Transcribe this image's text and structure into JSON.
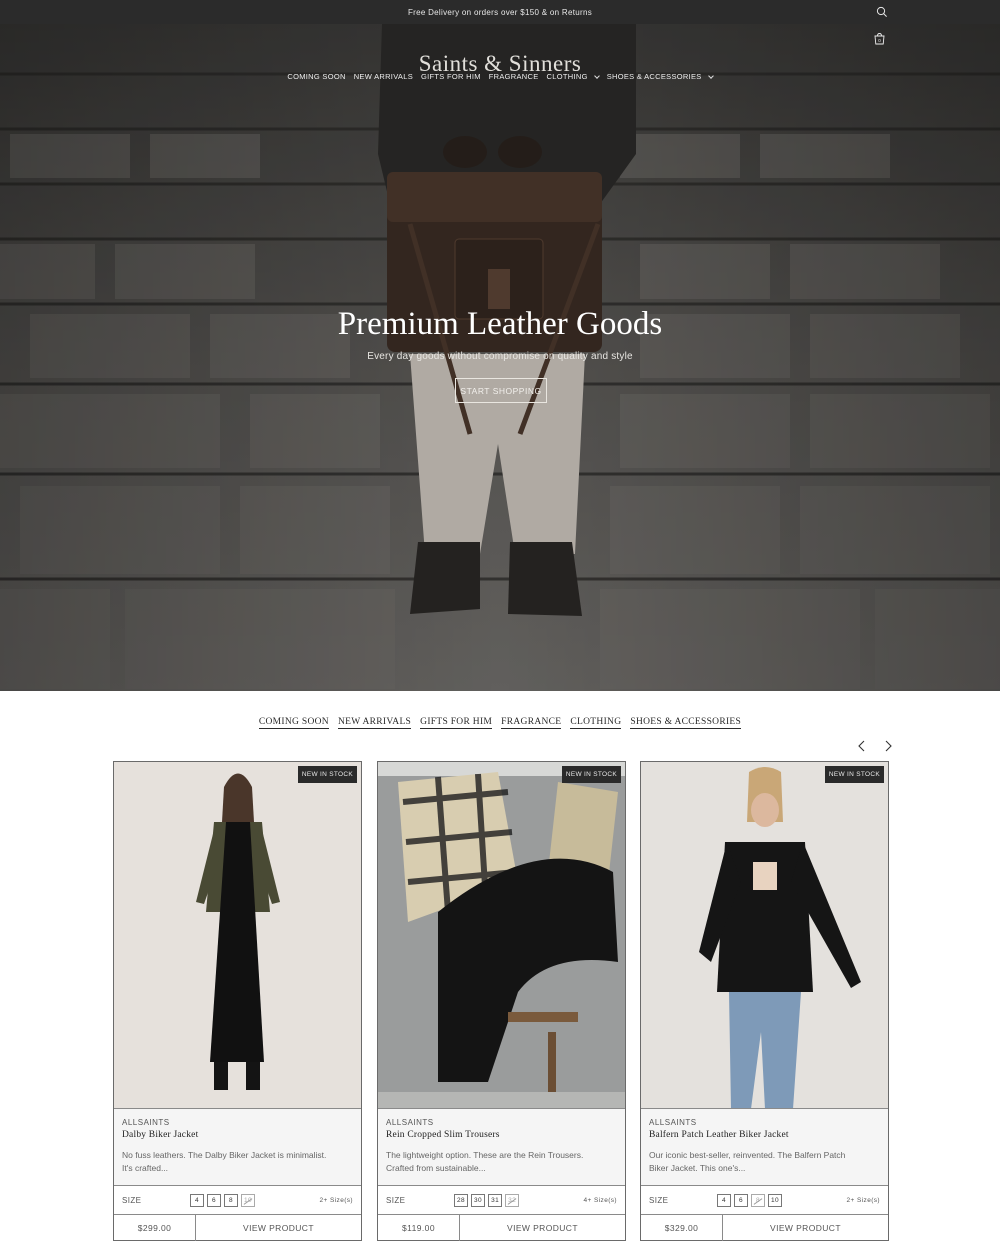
{
  "announcement": "Free Delivery on orders over $150 & on Returns",
  "brand": "Saints & Sinners",
  "cart_count": "0",
  "nav": [
    {
      "label": "COMING SOON"
    },
    {
      "label": "NEW ARRIVALS"
    },
    {
      "label": "GIFTS FOR HIM"
    },
    {
      "label": "FRAGRANCE"
    },
    {
      "label": "CLOTHING",
      "dropdown": true
    },
    {
      "label": "SHOES & ACCESSORIES",
      "dropdown": true
    }
  ],
  "hero": {
    "title": "Premium Leather Goods",
    "subtitle": "Every day goods without compromise on quality and style",
    "cta": "START SHOPPING"
  },
  "categories": [
    "COMING SOON",
    "NEW ARRIVALS",
    "GIFTS FOR HIM",
    "FRAGRANCE",
    "CLOTHING",
    "SHOES & ACCESSORIES"
  ],
  "products": [
    {
      "badge": "NEW IN STOCK",
      "brand": "ALLSAINTS",
      "name": "Dalby Biker Jacket",
      "desc_line1": "No fuss leathers. The Dalby Biker Jacket is minimalist.",
      "desc_line2": "It's crafted...",
      "size_label": "SIZE",
      "sizes": [
        {
          "v": "4",
          "out": false
        },
        {
          "v": "6",
          "out": false
        },
        {
          "v": "8",
          "out": false
        },
        {
          "v": "10",
          "out": true
        }
      ],
      "more_sizes": "2+ Size(s)",
      "price": "$299.00",
      "view": "VIEW PRODUCT"
    },
    {
      "badge": "NEW IN STOCK",
      "brand": "ALLSAINTS",
      "name": "Rein Cropped Slim Trousers",
      "desc_line1": "The lightweight option. These are the Rein Trousers.",
      "desc_line2": "Crafted from sustainable...",
      "size_label": "SIZE",
      "sizes": [
        {
          "v": "28",
          "out": false
        },
        {
          "v": "30",
          "out": false
        },
        {
          "v": "31",
          "out": false
        },
        {
          "v": "32",
          "out": true
        }
      ],
      "more_sizes": "4+ Size(s)",
      "price": "$119.00",
      "view": "VIEW PRODUCT"
    },
    {
      "badge": "NEW IN STOCK",
      "brand": "ALLSAINTS",
      "name": "Balfern Patch Leather Biker Jacket",
      "desc_line1": "Our iconic best-seller, reinvented. The Balfern Patch",
      "desc_line2": "Biker Jacket. This one's...",
      "size_label": "SIZE",
      "sizes": [
        {
          "v": "4",
          "out": false
        },
        {
          "v": "6",
          "out": false
        },
        {
          "v": "8",
          "out": true
        },
        {
          "v": "10",
          "out": false
        }
      ],
      "more_sizes": "2+ Size(s)",
      "price": "$329.00",
      "view": "VIEW PRODUCT"
    }
  ]
}
